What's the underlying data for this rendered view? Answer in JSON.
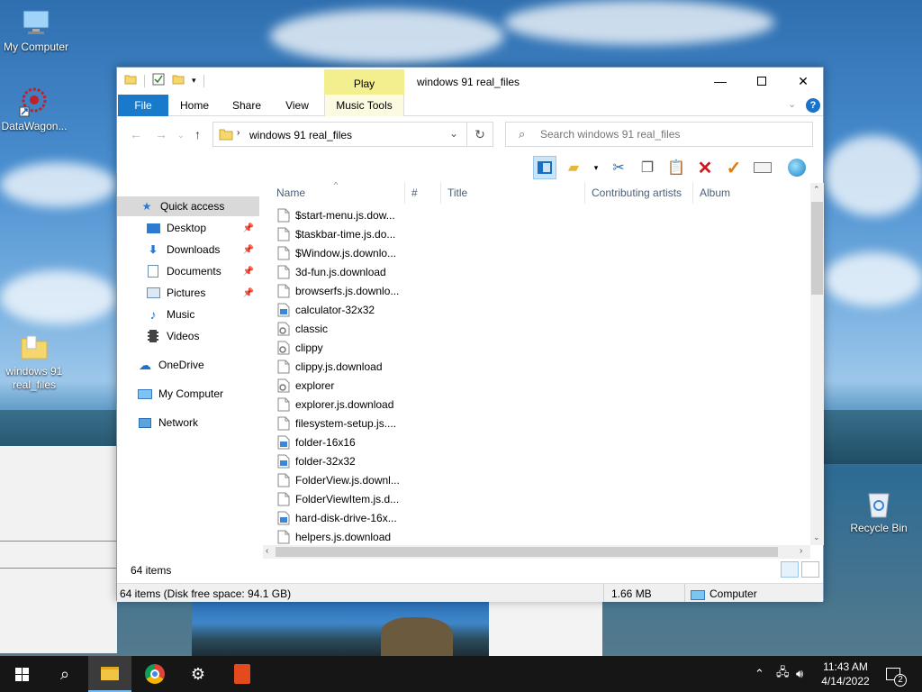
{
  "desktop": {
    "icons": [
      {
        "label": "My Computer"
      },
      {
        "label": "DataWagon..."
      },
      {
        "label": "windows 91 real_files"
      },
      {
        "label": "Recycle Bin"
      }
    ]
  },
  "window": {
    "title": "windows 91 real_files",
    "contextual_tab_group": "Play",
    "ribbon_tabs": [
      "File",
      "Home",
      "Share",
      "View",
      "Music Tools"
    ],
    "address": "windows 91 real_files",
    "search_placeholder": "Search windows 91 real_files",
    "nav": {
      "quick_access": "Quick access",
      "desktop": "Desktop",
      "downloads": "Downloads",
      "documents": "Documents",
      "pictures": "Pictures",
      "music": "Music",
      "videos": "Videos",
      "onedrive": "OneDrive",
      "my_computer": "My Computer",
      "network": "Network"
    },
    "columns": [
      "Name",
      "#",
      "Title",
      "Contributing artists",
      "Album"
    ],
    "files": [
      {
        "name": "$start-menu.js.dow...",
        "type": "doc"
      },
      {
        "name": "$taskbar-time.js.do...",
        "type": "doc"
      },
      {
        "name": "$Window.js.downlo...",
        "type": "doc"
      },
      {
        "name": "3d-fun.js.download",
        "type": "doc"
      },
      {
        "name": "browserfs.js.downlo...",
        "type": "doc"
      },
      {
        "name": "calculator-32x32",
        "type": "img"
      },
      {
        "name": "classic",
        "type": "gear"
      },
      {
        "name": "clippy",
        "type": "gear"
      },
      {
        "name": "clippy.js.download",
        "type": "doc"
      },
      {
        "name": "explorer",
        "type": "gear"
      },
      {
        "name": "explorer.js.download",
        "type": "doc"
      },
      {
        "name": "filesystem-setup.js....",
        "type": "doc"
      },
      {
        "name": "folder-16x16",
        "type": "img"
      },
      {
        "name": "folder-32x32",
        "type": "img"
      },
      {
        "name": "FolderView.js.downl...",
        "type": "doc"
      },
      {
        "name": "FolderViewItem.js.d...",
        "type": "doc"
      },
      {
        "name": "hard-disk-drive-16x...",
        "type": "img"
      },
      {
        "name": "helpers.js.download",
        "type": "doc"
      }
    ],
    "item_count": "64 items",
    "status": {
      "left": "64 items (Disk free space: 94.1 GB)",
      "size": "1.66 MB",
      "location": "Computer"
    }
  },
  "taskbar": {
    "time": "11:43 AM",
    "date": "4/14/2022",
    "notification_count": "2"
  }
}
